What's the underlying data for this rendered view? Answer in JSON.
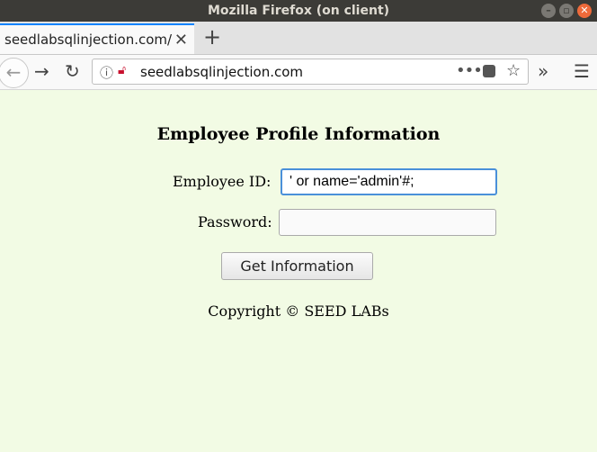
{
  "window": {
    "title": "Mozilla Firefox (on client)",
    "controls": [
      "minimize-icon",
      "maximize-icon",
      "close-icon"
    ]
  },
  "tab": {
    "label": "seedlabsqlinjection.com/",
    "close_glyph": "✕",
    "new_tab_glyph": "+"
  },
  "navbar": {
    "url": "seedlabsqlinjection.com",
    "icons": [
      "back-icon",
      "forward-icon",
      "reload-icon",
      "info-icon",
      "insecure-lock-icon",
      "page-actions-icon",
      "pocket-icon",
      "bookmark-star-icon",
      "overflow-icon",
      "menu-icon"
    ]
  },
  "page": {
    "title": "Employee Profile Information",
    "employee_id_label": "Employee ID:",
    "employee_id_value": "' or name='admin'#;",
    "password_label": "Password:",
    "password_value": "",
    "submit_label": "Get Information",
    "copyright": "Copyright © SEED LABs"
  },
  "colors": {
    "page_background": "#f2fbe4",
    "titlebar": "#3c3b37",
    "focus_border": "#4a90d9",
    "tab_accent": "#0a84ff"
  }
}
